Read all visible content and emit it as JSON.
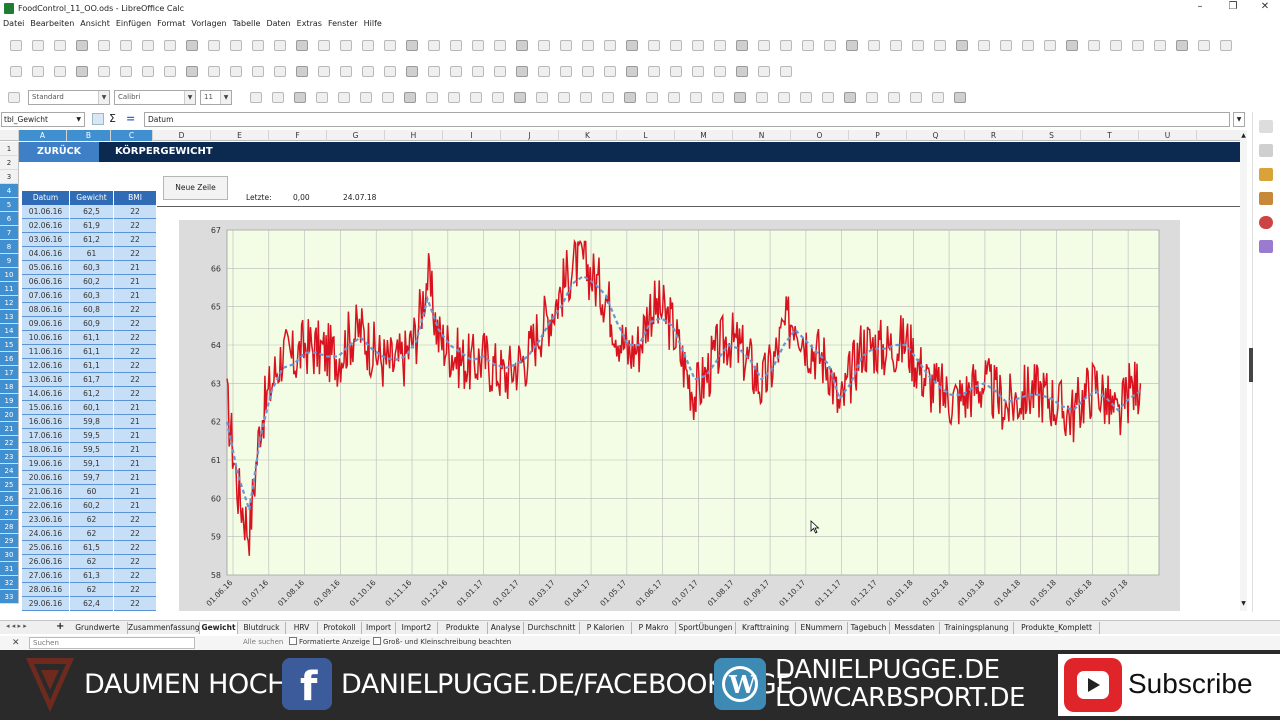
{
  "window": {
    "title": "FoodControl_11_OO.ods - LibreOffice Calc",
    "min": "–",
    "max": "❐",
    "close": "✕"
  },
  "menu": [
    "Datei",
    "Bearbeiten",
    "Ansicht",
    "Einfügen",
    "Format",
    "Vorlagen",
    "Tabelle",
    "Daten",
    "Extras",
    "Fenster",
    "Hilfe"
  ],
  "format_bar": {
    "style": "Standard",
    "font": "Calibri",
    "size": "11"
  },
  "formula_bar": {
    "namebox": "tbl_Gewicht",
    "sigma": "Σ",
    "equals": "=",
    "content": "Datum"
  },
  "columns": [
    "A",
    "B",
    "C",
    "D",
    "E",
    "F",
    "G",
    "H",
    "I",
    "J",
    "K",
    "L",
    "M",
    "N",
    "O",
    "P",
    "Q",
    "R",
    "S",
    "T",
    "U"
  ],
  "rows": [
    "1",
    "2",
    "3",
    "4",
    "5",
    "6",
    "7",
    "8",
    "9",
    "10",
    "11",
    "12",
    "13",
    "14",
    "15",
    "16",
    "17",
    "18",
    "19",
    "20",
    "21",
    "22",
    "23",
    "24",
    "25",
    "26",
    "27",
    "28",
    "29",
    "30",
    "31",
    "32",
    "33"
  ],
  "banner": {
    "back": "ZURÜCK",
    "title": "KÖRPERGEWICHT"
  },
  "button_new_row": "Neue Zeile",
  "letzte": {
    "label": "Letzte:",
    "value": "0,00",
    "date": "24.07.18"
  },
  "table": {
    "headers": [
      "Datum",
      "Gewicht",
      "BMI"
    ],
    "rows": [
      [
        "01.06.16",
        "62,5",
        "22"
      ],
      [
        "02.06.16",
        "61,9",
        "22"
      ],
      [
        "03.06.16",
        "61,2",
        "22"
      ],
      [
        "04.06.16",
        "61",
        "22"
      ],
      [
        "05.06.16",
        "60,3",
        "21"
      ],
      [
        "06.06.16",
        "60,2",
        "21"
      ],
      [
        "07.06.16",
        "60,3",
        "21"
      ],
      [
        "08.06.16",
        "60,8",
        "22"
      ],
      [
        "09.06.16",
        "60,9",
        "22"
      ],
      [
        "10.06.16",
        "61,1",
        "22"
      ],
      [
        "11.06.16",
        "61,1",
        "22"
      ],
      [
        "12.06.16",
        "61,1",
        "22"
      ],
      [
        "13.06.16",
        "61,7",
        "22"
      ],
      [
        "14.06.16",
        "61,2",
        "22"
      ],
      [
        "15.06.16",
        "60,1",
        "21"
      ],
      [
        "16.06.16",
        "59,8",
        "21"
      ],
      [
        "17.06.16",
        "59,5",
        "21"
      ],
      [
        "18.06.16",
        "59,5",
        "21"
      ],
      [
        "19.06.16",
        "59,1",
        "21"
      ],
      [
        "20.06.16",
        "59,7",
        "21"
      ],
      [
        "21.06.16",
        "60",
        "21"
      ],
      [
        "22.06.16",
        "60,2",
        "21"
      ],
      [
        "23.06.16",
        "62",
        "22"
      ],
      [
        "24.06.16",
        "62",
        "22"
      ],
      [
        "25.06.16",
        "61,5",
        "22"
      ],
      [
        "26.06.16",
        "62",
        "22"
      ],
      [
        "27.06.16",
        "61,3",
        "22"
      ],
      [
        "28.06.16",
        "62",
        "22"
      ],
      [
        "29.06.16",
        "62,4",
        "22"
      ]
    ]
  },
  "chart_data": {
    "type": "line",
    "ylim": [
      58,
      67
    ],
    "yticks": [
      "58",
      "59",
      "60",
      "61",
      "62",
      "63",
      "64",
      "65",
      "66",
      "67"
    ],
    "x_tick_labels": [
      "01.06.16",
      "01.07.16",
      "01.08.16",
      "01.09.16",
      "01.10.16",
      "01.11.16",
      "01.12.16",
      "01.01.17",
      "01.02.17",
      "01.03.17",
      "01.04.17",
      "01.05.17",
      "01.06.17",
      "01.07.17",
      "01.08.17",
      "01.09.17",
      "01.10.17",
      "01.11.17",
      "01.12.17",
      "01.01.18",
      "01.02.18",
      "01.03.18",
      "01.04.18",
      "01.05.18",
      "01.06.18",
      "01.07.18"
    ],
    "grid": true,
    "series": [
      {
        "color": "#d8121e",
        "style": "solid",
        "anchor_values": [
          62.5,
          60.2,
          59.1,
          62.0,
          63.0,
          63.8,
          63.6,
          64.0,
          63.9,
          63.8,
          63.7,
          64.2,
          64.4,
          63.9,
          63.6,
          63.5,
          63.7,
          64.3,
          65.8,
          64.2,
          63.9,
          63.6,
          63.5,
          63.7,
          63.4,
          63.2,
          63.5,
          63.7,
          64.4,
          64.8,
          65.4,
          66.1,
          66.2,
          65.7,
          65.3,
          64.4,
          63.8,
          64.0,
          65.0,
          64.9,
          64.5,
          63.5,
          62.7,
          63.2,
          63.8,
          64.2,
          63.9,
          63.5,
          62.9,
          63.5,
          64.4,
          64.8,
          64.1,
          63.8,
          63.5,
          62.3,
          63.2,
          64.0,
          64.0,
          63.9,
          64.0,
          64.1,
          63.5,
          63.0,
          62.8,
          62.6,
          62.6,
          62.9,
          63.0,
          62.7,
          62.4,
          62.6,
          62.8,
          62.8,
          62.6,
          62.3,
          62.2,
          62.7,
          63.0,
          62.5,
          62.0,
          62.8,
          63.0
        ]
      },
      {
        "color": "#6b97d2",
        "style": "dashed",
        "name_hidden": true,
        "anchor_values": [
          62.0,
          60.6,
          59.7,
          61.6,
          62.8,
          63.4,
          63.5,
          63.8,
          63.8,
          63.7,
          63.7,
          64.0,
          64.2,
          63.9,
          63.7,
          63.6,
          63.7,
          64.1,
          65.2,
          64.4,
          64.0,
          63.8,
          63.6,
          63.7,
          63.5,
          63.4,
          63.5,
          63.7,
          64.1,
          64.6,
          65.0,
          65.6,
          65.8,
          65.6,
          65.3,
          64.6,
          64.0,
          64.0,
          64.6,
          64.7,
          64.5,
          63.8,
          63.1,
          63.2,
          63.6,
          64.0,
          63.9,
          63.6,
          63.1,
          63.4,
          64.0,
          64.4,
          64.1,
          63.8,
          63.5,
          62.6,
          63.0,
          63.7,
          63.9,
          63.9,
          64.0,
          64.0,
          63.6,
          63.2,
          62.9,
          62.7,
          62.7,
          62.9,
          63.0,
          62.8,
          62.5,
          62.6,
          62.7,
          62.7,
          62.6,
          62.4,
          62.3,
          62.6,
          62.8,
          62.6,
          62.3,
          62.6,
          62.8
        ]
      }
    ]
  },
  "sheet_tabs": [
    "Grundwerte",
    "Zusammenfassung",
    "Gewicht",
    "Blutdruck",
    "HRV",
    "Protokoll",
    "Import",
    "Import2",
    "Produkte",
    "Analyse",
    "Durchschnitt",
    "P Kalorien",
    "P Makro",
    "SportÜbungen",
    "Krafttraining",
    "ENummern",
    "Tagebuch",
    "Messdaten",
    "Trainingsplanung",
    "Produkte_Komplett"
  ],
  "active_tab": "Gewicht",
  "findbar": {
    "placeholder": "Suchen",
    "find_all": "Alle suchen",
    "formatted": "Formatierte Anzeige",
    "match_case": "Groß- und Kleinschreibung beachten"
  },
  "bottom": {
    "left": "DAUMEN HOCH",
    "fb": "DANIELPUGGE.DE/FACEBOOKPAGE",
    "wp1": "DANIELPUGGE.DE",
    "wp2": "LOWCARBSPORT.DE",
    "subscribe": "Subscribe"
  },
  "colors": {
    "banner": "#0c2a4f",
    "zurueck": "#3f7fc6",
    "table_header": "#2f6cb5",
    "table_cell": "#c6def6",
    "plot_bg": "#f3fde5"
  }
}
